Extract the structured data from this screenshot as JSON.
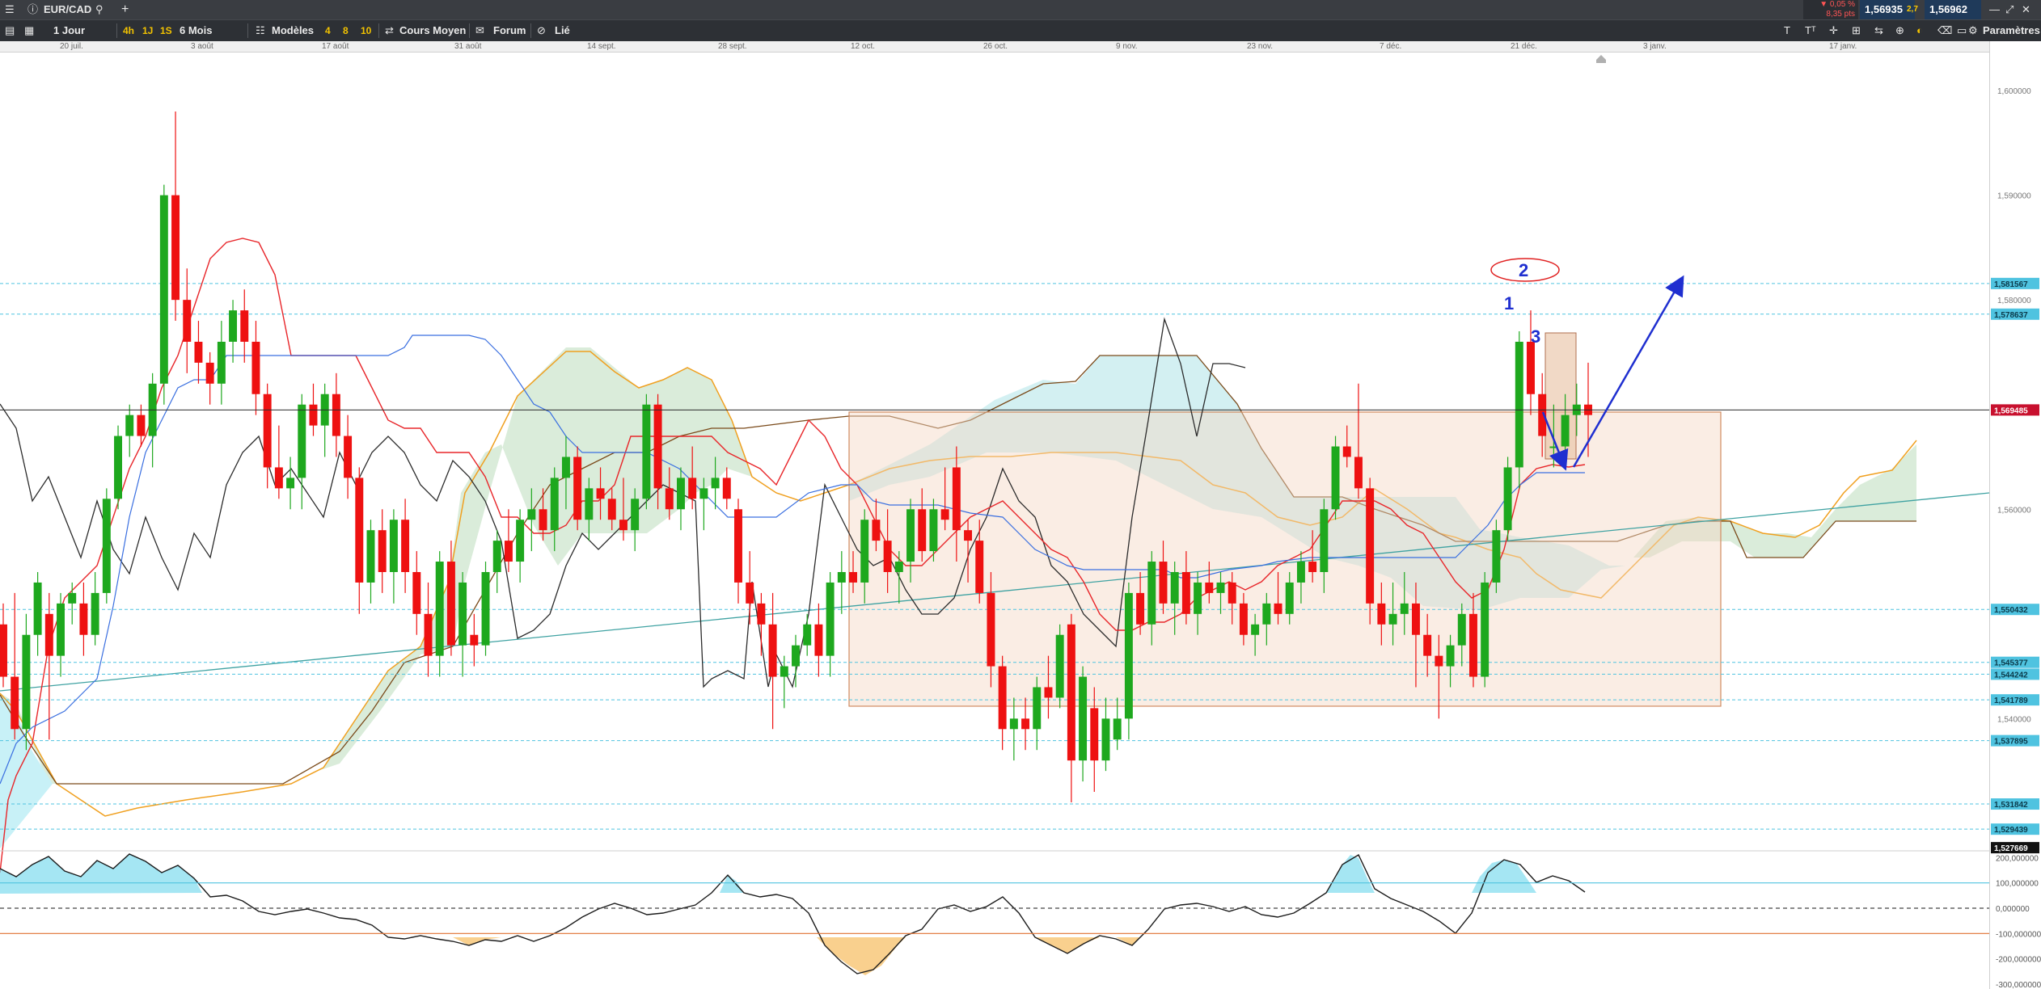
{
  "header": {
    "symbol": "EUR/CAD",
    "change_pct": "▼ 0,05 %",
    "change_pts": "8,35 pts",
    "bid": "1,56935",
    "spread": "2,7",
    "ask": "1,56962",
    "add_symbol": "+"
  },
  "toolbar": {
    "period": "1 Jour",
    "quick_periods": [
      "4h",
      "1J",
      "1S"
    ],
    "range": "6 Mois",
    "models_label": "Modèles",
    "model_counts": [
      "4",
      "8",
      "10"
    ],
    "course_label": "Cours Moyen",
    "forum_label": "Forum",
    "linked_label": "Lié",
    "settings_label": "Paramètres"
  },
  "dates": [
    "20 juil.",
    "3 août",
    "17 août",
    "31 août",
    "14 sept.",
    "28 sept.",
    "12 oct.",
    "26 oct.",
    "9 nov.",
    "23 nov.",
    "7 déc.",
    "21 déc.",
    "3 janv.",
    "17 janv."
  ],
  "annotations": [
    "1",
    "2",
    "3"
  ],
  "colors": {
    "up": "#1ea81e",
    "down": "#ee1111",
    "tenkan": "#e8262a",
    "kijun": "#3a6fe0",
    "chikou": "#2b2b2b",
    "ssa": "#f0a020",
    "ssb": "#7a4a1a",
    "cloud_bull": "#cfe8cf",
    "cloud_bear": "#bfeff5",
    "zone": "#f3d6c4",
    "level": "#4fc3e0",
    "arrow": "#1f2fd0",
    "price_label": "#c8102e"
  },
  "chart_data": [
    {
      "type": "candlestick",
      "title": "EUR/CAD",
      "timeframe": "1 Jour",
      "ylim": [
        1.5276,
        1.6034
      ],
      "x_ticks": [
        "20 juil.",
        "3 août",
        "17 août",
        "31 août",
        "14 sept.",
        "28 sept.",
        "12 oct.",
        "26 oct.",
        "9 nov.",
        "23 nov.",
        "7 déc.",
        "21 déc.",
        "3 janv.",
        "17 janv."
      ],
      "y_tick_labels": [
        "1,600000",
        "1,590000",
        "1,580000",
        "1,560000",
        "1,540000"
      ],
      "y_tick_values": [
        1.6,
        1.59,
        1.58,
        1.56,
        1.54
      ],
      "price_labels": [
        "1,581567",
        "1,578637",
        "1,569485",
        "1,550432",
        "1,545377",
        "1,544242",
        "1,541789",
        "1,537895",
        "1,531842",
        "1,529439",
        "1,527669"
      ],
      "price_label_values": [
        1.581567,
        1.578637,
        1.569485,
        1.550432,
        1.545377,
        1.544242,
        1.541789,
        1.537895,
        1.531842,
        1.529439,
        1.527669
      ],
      "current_price": 1.569485,
      "candles": [
        {
          "o": 1.549,
          "h": 1.551,
          "l": 1.543,
          "c": 1.544
        },
        {
          "o": 1.544,
          "h": 1.552,
          "l": 1.538,
          "c": 1.539
        },
        {
          "o": 1.539,
          "h": 1.55,
          "l": 1.537,
          "c": 1.548
        },
        {
          "o": 1.548,
          "h": 1.554,
          "l": 1.546,
          "c": 1.553
        },
        {
          "o": 1.55,
          "h": 1.552,
          "l": 1.538,
          "c": 1.546
        },
        {
          "o": 1.546,
          "h": 1.552,
          "l": 1.544,
          "c": 1.551
        },
        {
          "o": 1.551,
          "h": 1.553,
          "l": 1.549,
          "c": 1.552
        },
        {
          "o": 1.551,
          "h": 1.553,
          "l": 1.546,
          "c": 1.548
        },
        {
          "o": 1.548,
          "h": 1.554,
          "l": 1.547,
          "c": 1.552
        },
        {
          "o": 1.552,
          "h": 1.562,
          "l": 1.551,
          "c": 1.561
        },
        {
          "o": 1.561,
          "h": 1.568,
          "l": 1.56,
          "c": 1.567
        },
        {
          "o": 1.567,
          "h": 1.57,
          "l": 1.565,
          "c": 1.569
        },
        {
          "o": 1.569,
          "h": 1.57,
          "l": 1.566,
          "c": 1.567
        },
        {
          "o": 1.567,
          "h": 1.573,
          "l": 1.564,
          "c": 1.572
        },
        {
          "o": 1.572,
          "h": 1.591,
          "l": 1.57,
          "c": 1.59
        },
        {
          "o": 1.59,
          "h": 1.598,
          "l": 1.578,
          "c": 1.58
        },
        {
          "o": 1.58,
          "h": 1.583,
          "l": 1.573,
          "c": 1.576
        },
        {
          "o": 1.576,
          "h": 1.578,
          "l": 1.572,
          "c": 1.574
        },
        {
          "o": 1.574,
          "h": 1.575,
          "l": 1.57,
          "c": 1.572
        },
        {
          "o": 1.572,
          "h": 1.578,
          "l": 1.57,
          "c": 1.576
        },
        {
          "o": 1.576,
          "h": 1.58,
          "l": 1.574,
          "c": 1.579
        },
        {
          "o": 1.579,
          "h": 1.581,
          "l": 1.574,
          "c": 1.576
        },
        {
          "o": 1.576,
          "h": 1.578,
          "l": 1.569,
          "c": 1.571
        },
        {
          "o": 1.571,
          "h": 1.572,
          "l": 1.562,
          "c": 1.564
        },
        {
          "o": 1.564,
          "h": 1.568,
          "l": 1.561,
          "c": 1.562
        },
        {
          "o": 1.562,
          "h": 1.565,
          "l": 1.56,
          "c": 1.563
        },
        {
          "o": 1.563,
          "h": 1.571,
          "l": 1.56,
          "c": 1.57
        },
        {
          "o": 1.57,
          "h": 1.572,
          "l": 1.567,
          "c": 1.568
        },
        {
          "o": 1.568,
          "h": 1.572,
          "l": 1.565,
          "c": 1.571
        },
        {
          "o": 1.571,
          "h": 1.573,
          "l": 1.565,
          "c": 1.567
        },
        {
          "o": 1.567,
          "h": 1.569,
          "l": 1.561,
          "c": 1.563
        },
        {
          "o": 1.563,
          "h": 1.564,
          "l": 1.55,
          "c": 1.553
        },
        {
          "o": 1.553,
          "h": 1.559,
          "l": 1.551,
          "c": 1.558
        },
        {
          "o": 1.558,
          "h": 1.56,
          "l": 1.552,
          "c": 1.554
        },
        {
          "o": 1.554,
          "h": 1.56,
          "l": 1.551,
          "c": 1.559
        },
        {
          "o": 1.559,
          "h": 1.561,
          "l": 1.552,
          "c": 1.554
        },
        {
          "o": 1.554,
          "h": 1.556,
          "l": 1.548,
          "c": 1.55
        },
        {
          "o": 1.55,
          "h": 1.553,
          "l": 1.544,
          "c": 1.546
        },
        {
          "o": 1.546,
          "h": 1.556,
          "l": 1.544,
          "c": 1.555
        },
        {
          "o": 1.555,
          "h": 1.557,
          "l": 1.546,
          "c": 1.547
        },
        {
          "o": 1.547,
          "h": 1.554,
          "l": 1.544,
          "c": 1.553
        },
        {
          "o": 1.548,
          "h": 1.55,
          "l": 1.545,
          "c": 1.547
        },
        {
          "o": 1.547,
          "h": 1.555,
          "l": 1.546,
          "c": 1.554
        },
        {
          "o": 1.554,
          "h": 1.558,
          "l": 1.552,
          "c": 1.557
        },
        {
          "o": 1.557,
          "h": 1.56,
          "l": 1.554,
          "c": 1.555
        },
        {
          "o": 1.555,
          "h": 1.56,
          "l": 1.553,
          "c": 1.559
        },
        {
          "o": 1.559,
          "h": 1.562,
          "l": 1.556,
          "c": 1.56
        },
        {
          "o": 1.56,
          "h": 1.562,
          "l": 1.557,
          "c": 1.558
        },
        {
          "o": 1.558,
          "h": 1.564,
          "l": 1.556,
          "c": 1.563
        },
        {
          "o": 1.563,
          "h": 1.567,
          "l": 1.56,
          "c": 1.565
        },
        {
          "o": 1.565,
          "h": 1.566,
          "l": 1.558,
          "c": 1.559
        },
        {
          "o": 1.559,
          "h": 1.563,
          "l": 1.557,
          "c": 1.562
        },
        {
          "o": 1.562,
          "h": 1.564,
          "l": 1.559,
          "c": 1.561
        },
        {
          "o": 1.561,
          "h": 1.562,
          "l": 1.558,
          "c": 1.559
        },
        {
          "o": 1.559,
          "h": 1.563,
          "l": 1.557,
          "c": 1.558
        },
        {
          "o": 1.558,
          "h": 1.562,
          "l": 1.556,
          "c": 1.561
        },
        {
          "o": 1.561,
          "h": 1.571,
          "l": 1.56,
          "c": 1.57
        },
        {
          "o": 1.57,
          "h": 1.571,
          "l": 1.56,
          "c": 1.562
        },
        {
          "o": 1.562,
          "h": 1.564,
          "l": 1.559,
          "c": 1.56
        },
        {
          "o": 1.56,
          "h": 1.564,
          "l": 1.558,
          "c": 1.563
        },
        {
          "o": 1.563,
          "h": 1.566,
          "l": 1.56,
          "c": 1.561
        },
        {
          "o": 1.561,
          "h": 1.563,
          "l": 1.558,
          "c": 1.562
        },
        {
          "o": 1.562,
          "h": 1.565,
          "l": 1.56,
          "c": 1.563
        },
        {
          "o": 1.563,
          "h": 1.564,
          "l": 1.56,
          "c": 1.561
        },
        {
          "o": 1.56,
          "h": 1.561,
          "l": 1.551,
          "c": 1.553
        },
        {
          "o": 1.553,
          "h": 1.556,
          "l": 1.549,
          "c": 1.551
        },
        {
          "o": 1.551,
          "h": 1.552,
          "l": 1.546,
          "c": 1.549
        },
        {
          "o": 1.549,
          "h": 1.552,
          "l": 1.539,
          "c": 1.544
        },
        {
          "o": 1.544,
          "h": 1.546,
          "l": 1.541,
          "c": 1.545
        },
        {
          "o": 1.545,
          "h": 1.548,
          "l": 1.543,
          "c": 1.547
        },
        {
          "o": 1.547,
          "h": 1.55,
          "l": 1.546,
          "c": 1.549
        },
        {
          "o": 1.549,
          "h": 1.551,
          "l": 1.544,
          "c": 1.546
        },
        {
          "o": 1.546,
          "h": 1.554,
          "l": 1.544,
          "c": 1.553
        },
        {
          "o": 1.553,
          "h": 1.556,
          "l": 1.55,
          "c": 1.554
        },
        {
          "o": 1.554,
          "h": 1.556,
          "l": 1.552,
          "c": 1.553
        },
        {
          "o": 1.553,
          "h": 1.56,
          "l": 1.551,
          "c": 1.559
        },
        {
          "o": 1.559,
          "h": 1.561,
          "l": 1.556,
          "c": 1.557
        },
        {
          "o": 1.557,
          "h": 1.56,
          "l": 1.552,
          "c": 1.554
        },
        {
          "o": 1.554,
          "h": 1.556,
          "l": 1.551,
          "c": 1.555
        },
        {
          "o": 1.555,
          "h": 1.561,
          "l": 1.553,
          "c": 1.56
        },
        {
          "o": 1.56,
          "h": 1.562,
          "l": 1.555,
          "c": 1.556
        },
        {
          "o": 1.556,
          "h": 1.561,
          "l": 1.555,
          "c": 1.56
        },
        {
          "o": 1.56,
          "h": 1.564,
          "l": 1.558,
          "c": 1.559
        },
        {
          "o": 1.564,
          "h": 1.566,
          "l": 1.555,
          "c": 1.558
        },
        {
          "o": 1.558,
          "h": 1.559,
          "l": 1.553,
          "c": 1.557
        },
        {
          "o": 1.557,
          "h": 1.559,
          "l": 1.551,
          "c": 1.552
        },
        {
          "o": 1.552,
          "h": 1.554,
          "l": 1.543,
          "c": 1.545
        },
        {
          "o": 1.545,
          "h": 1.546,
          "l": 1.537,
          "c": 1.539
        },
        {
          "o": 1.539,
          "h": 1.542,
          "l": 1.536,
          "c": 1.54
        },
        {
          "o": 1.54,
          "h": 1.542,
          "l": 1.537,
          "c": 1.539
        },
        {
          "o": 1.539,
          "h": 1.544,
          "l": 1.537,
          "c": 1.543
        },
        {
          "o": 1.543,
          "h": 1.546,
          "l": 1.54,
          "c": 1.542
        },
        {
          "o": 1.542,
          "h": 1.549,
          "l": 1.541,
          "c": 1.548
        },
        {
          "o": 1.549,
          "h": 1.55,
          "l": 1.532,
          "c": 1.536
        },
        {
          "o": 1.536,
          "h": 1.545,
          "l": 1.534,
          "c": 1.544
        },
        {
          "o": 1.541,
          "h": 1.543,
          "l": 1.533,
          "c": 1.536
        },
        {
          "o": 1.536,
          "h": 1.542,
          "l": 1.535,
          "c": 1.54
        },
        {
          "o": 1.538,
          "h": 1.542,
          "l": 1.537,
          "c": 1.54
        },
        {
          "o": 1.54,
          "h": 1.553,
          "l": 1.538,
          "c": 1.552
        },
        {
          "o": 1.552,
          "h": 1.554,
          "l": 1.548,
          "c": 1.549
        },
        {
          "o": 1.549,
          "h": 1.556,
          "l": 1.547,
          "c": 1.555
        },
        {
          "o": 1.555,
          "h": 1.557,
          "l": 1.55,
          "c": 1.551
        },
        {
          "o": 1.551,
          "h": 1.555,
          "l": 1.548,
          "c": 1.554
        },
        {
          "o": 1.554,
          "h": 1.556,
          "l": 1.549,
          "c": 1.55
        },
        {
          "o": 1.55,
          "h": 1.554,
          "l": 1.548,
          "c": 1.553
        },
        {
          "o": 1.553,
          "h": 1.555,
          "l": 1.551,
          "c": 1.552
        },
        {
          "o": 1.552,
          "h": 1.554,
          "l": 1.55,
          "c": 1.553
        },
        {
          "o": 1.553,
          "h": 1.554,
          "l": 1.549,
          "c": 1.551
        },
        {
          "o": 1.551,
          "h": 1.552,
          "l": 1.547,
          "c": 1.548
        },
        {
          "o": 1.548,
          "h": 1.55,
          "l": 1.546,
          "c": 1.549
        },
        {
          "o": 1.549,
          "h": 1.552,
          "l": 1.547,
          "c": 1.551
        },
        {
          "o": 1.551,
          "h": 1.554,
          "l": 1.549,
          "c": 1.55
        },
        {
          "o": 1.55,
          "h": 1.554,
          "l": 1.549,
          "c": 1.553
        },
        {
          "o": 1.553,
          "h": 1.556,
          "l": 1.551,
          "c": 1.555
        },
        {
          "o": 1.555,
          "h": 1.558,
          "l": 1.553,
          "c": 1.554
        },
        {
          "o": 1.554,
          "h": 1.561,
          "l": 1.552,
          "c": 1.56
        },
        {
          "o": 1.56,
          "h": 1.567,
          "l": 1.559,
          "c": 1.566
        },
        {
          "o": 1.566,
          "h": 1.568,
          "l": 1.564,
          "c": 1.565
        },
        {
          "o": 1.565,
          "h": 1.572,
          "l": 1.561,
          "c": 1.562
        },
        {
          "o": 1.562,
          "h": 1.563,
          "l": 1.549,
          "c": 1.551
        },
        {
          "o": 1.551,
          "h": 1.553,
          "l": 1.547,
          "c": 1.549
        },
        {
          "o": 1.549,
          "h": 1.553,
          "l": 1.547,
          "c": 1.55
        },
        {
          "o": 1.55,
          "h": 1.554,
          "l": 1.548,
          "c": 1.551
        },
        {
          "o": 1.551,
          "h": 1.553,
          "l": 1.543,
          "c": 1.548
        },
        {
          "o": 1.548,
          "h": 1.55,
          "l": 1.544,
          "c": 1.546
        },
        {
          "o": 1.546,
          "h": 1.548,
          "l": 1.54,
          "c": 1.545
        },
        {
          "o": 1.545,
          "h": 1.548,
          "l": 1.543,
          "c": 1.547
        },
        {
          "o": 1.547,
          "h": 1.551,
          "l": 1.545,
          "c": 1.55
        },
        {
          "o": 1.55,
          "h": 1.552,
          "l": 1.543,
          "c": 1.544
        },
        {
          "o": 1.544,
          "h": 1.554,
          "l": 1.543,
          "c": 1.553
        },
        {
          "o": 1.553,
          "h": 1.559,
          "l": 1.552,
          "c": 1.558
        },
        {
          "o": 1.558,
          "h": 1.565,
          "l": 1.557,
          "c": 1.564
        },
        {
          "o": 1.564,
          "h": 1.577,
          "l": 1.562,
          "c": 1.576
        },
        {
          "o": 1.576,
          "h": 1.579,
          "l": 1.569,
          "c": 1.571
        },
        {
          "o": 1.571,
          "h": 1.573,
          "l": 1.565,
          "c": 1.567
        },
        {
          "o": 1.566,
          "h": 1.57,
          "l": 1.564,
          "c": 1.566
        },
        {
          "o": 1.566,
          "h": 1.571,
          "l": 1.565,
          "c": 1.569
        },
        {
          "o": 1.569,
          "h": 1.572,
          "l": 1.567,
          "c": 1.57
        },
        {
          "o": 1.57,
          "h": 1.574,
          "l": 1.565,
          "c": 1.569
        }
      ]
    },
    {
      "type": "line",
      "title": "",
      "ylim": [
        -300,
        300
      ],
      "y_tick_labels": [
        "200,000000",
        "100,000000",
        "0,000000",
        "-100,000000",
        "-200,000000",
        "-300,000000"
      ],
      "y_tick_values": [
        200,
        100,
        0,
        -100,
        -200,
        -300
      ],
      "levels": [
        100,
        0,
        -100
      ]
    }
  ]
}
